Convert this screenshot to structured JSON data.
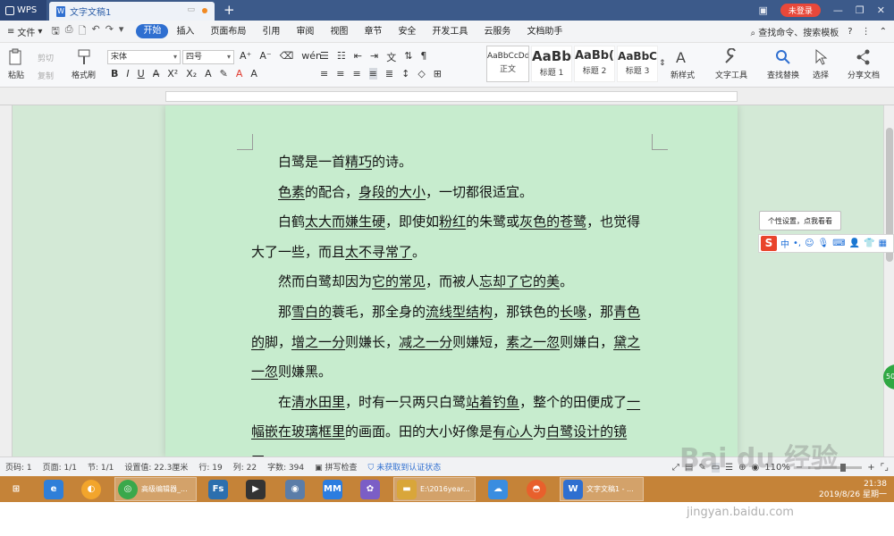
{
  "titlebar": {
    "app_name": "WPS",
    "doc_tab": "文字文稿1",
    "new_tab": "+",
    "login": "未登录"
  },
  "menubar": {
    "file": "文件",
    "items": [
      "开始",
      "插入",
      "页面布局",
      "引用",
      "审阅",
      "视图",
      "章节",
      "安全",
      "开发工具",
      "云服务",
      "文档助手"
    ],
    "search": "查找命令、搜索模板",
    "help": "?"
  },
  "ribbon": {
    "paste": "粘贴",
    "cut": "剪切",
    "copy": "复制",
    "format_painter": "格式刷",
    "font_name": "宋体",
    "font_size": "四号",
    "styles": [
      {
        "sample": "AaBbCcDd",
        "name": "正文"
      },
      {
        "sample": "AaBb",
        "name": "标题 1"
      },
      {
        "sample": "AaBb(",
        "name": "标题 2"
      },
      {
        "sample": "AaBbC",
        "name": "标题 3"
      }
    ],
    "new_style": "新样式",
    "text_tools": "文字工具",
    "find_replace": "查找替换",
    "select": "选择",
    "share": "分享文档"
  },
  "document": {
    "paragraphs": [
      [
        {
          "t": "白鹭是一首"
        },
        {
          "t": "精巧",
          "u": true
        },
        {
          "t": "的诗。"
        }
      ],
      [
        {
          "t": "色素",
          "u": true
        },
        {
          "t": "的配合，"
        },
        {
          "t": "身段的大小",
          "u": true
        },
        {
          "t": "，一切都很适宜。"
        }
      ],
      [
        {
          "t": "白鹤"
        },
        {
          "t": "太大而嫌生硬",
          "u": true
        },
        {
          "t": "，即使如"
        },
        {
          "t": "粉红",
          "u": true
        },
        {
          "t": "的朱鹭或"
        },
        {
          "t": "灰色的苍鹭",
          "u": true
        },
        {
          "t": "，也觉得大了一些，而且"
        },
        {
          "t": "太不寻常了",
          "u": true
        },
        {
          "t": "。"
        }
      ],
      [
        {
          "t": "然而白鹭却因为"
        },
        {
          "t": "它的常见",
          "u": true
        },
        {
          "t": "，而被人"
        },
        {
          "t": "忘却了它的美",
          "u": true
        },
        {
          "t": "。"
        }
      ],
      [
        {
          "t": "那"
        },
        {
          "t": "雪白的",
          "u": true
        },
        {
          "t": "蓑毛，那全身的"
        },
        {
          "t": "流线型结构",
          "u": true
        },
        {
          "t": "，那铁色的"
        },
        {
          "t": "长喙",
          "u": true
        },
        {
          "t": "，那"
        },
        {
          "t": "青色的",
          "u": true
        },
        {
          "t": "脚，"
        },
        {
          "t": "增之一分",
          "u": true
        },
        {
          "t": "则嫌长，"
        },
        {
          "t": "减之一分",
          "u": true
        },
        {
          "t": "则嫌短，"
        },
        {
          "t": "素之一忽",
          "u": true
        },
        {
          "t": "则嫌白，"
        },
        {
          "t": "黛之一忽",
          "u": true
        },
        {
          "t": "则嫌黑。"
        }
      ],
      [
        {
          "t": "在"
        },
        {
          "t": "清水田里",
          "u": true
        },
        {
          "t": "，时有一只两只白鹭"
        },
        {
          "t": "站着钓鱼",
          "u": true
        },
        {
          "t": "，整个的田便成了"
        },
        {
          "t": "一幅嵌在玻璃框里",
          "u": true
        },
        {
          "t": "的画面。田的大小好像是"
        },
        {
          "t": "有心人",
          "u": true
        },
        {
          "t": "为"
        },
        {
          "t": "白鹭设计的镜匣",
          "u": true
        },
        {
          "t": "。"
        }
      ]
    ]
  },
  "ime": {
    "tooltip": "个性设置，点我看看",
    "mode": "中",
    "punct": "•,"
  },
  "statusbar": {
    "page_num": "页码: 1",
    "pages": "页面: 1/1",
    "section": "节: 1/1",
    "setting": "设置值: 22.3厘米",
    "row": "行: 19",
    "col": "列: 22",
    "words": "字数: 394",
    "spell": "拼写检查",
    "auth": "未获取到认证状态",
    "zoom": "110%"
  },
  "taskbar": {
    "items": [
      {
        "label": "高级编辑器_...",
        "color": "#3aa84b"
      },
      {
        "label": "E:\\2016year...",
        "color": "#d9a63a"
      },
      {
        "label": "文字文稿1 - ...",
        "color": "#2f6fd0"
      }
    ],
    "time": "21:38",
    "date": "2019/8/26 星期一"
  },
  "watermark": {
    "text": "Bai du 经验",
    "url": "jingyan.baidu.com"
  },
  "colors": {
    "accent": "#2f6fd0",
    "page_bg": "#c7ecce",
    "taskbar": "#c58338",
    "login": "#e8483a"
  }
}
